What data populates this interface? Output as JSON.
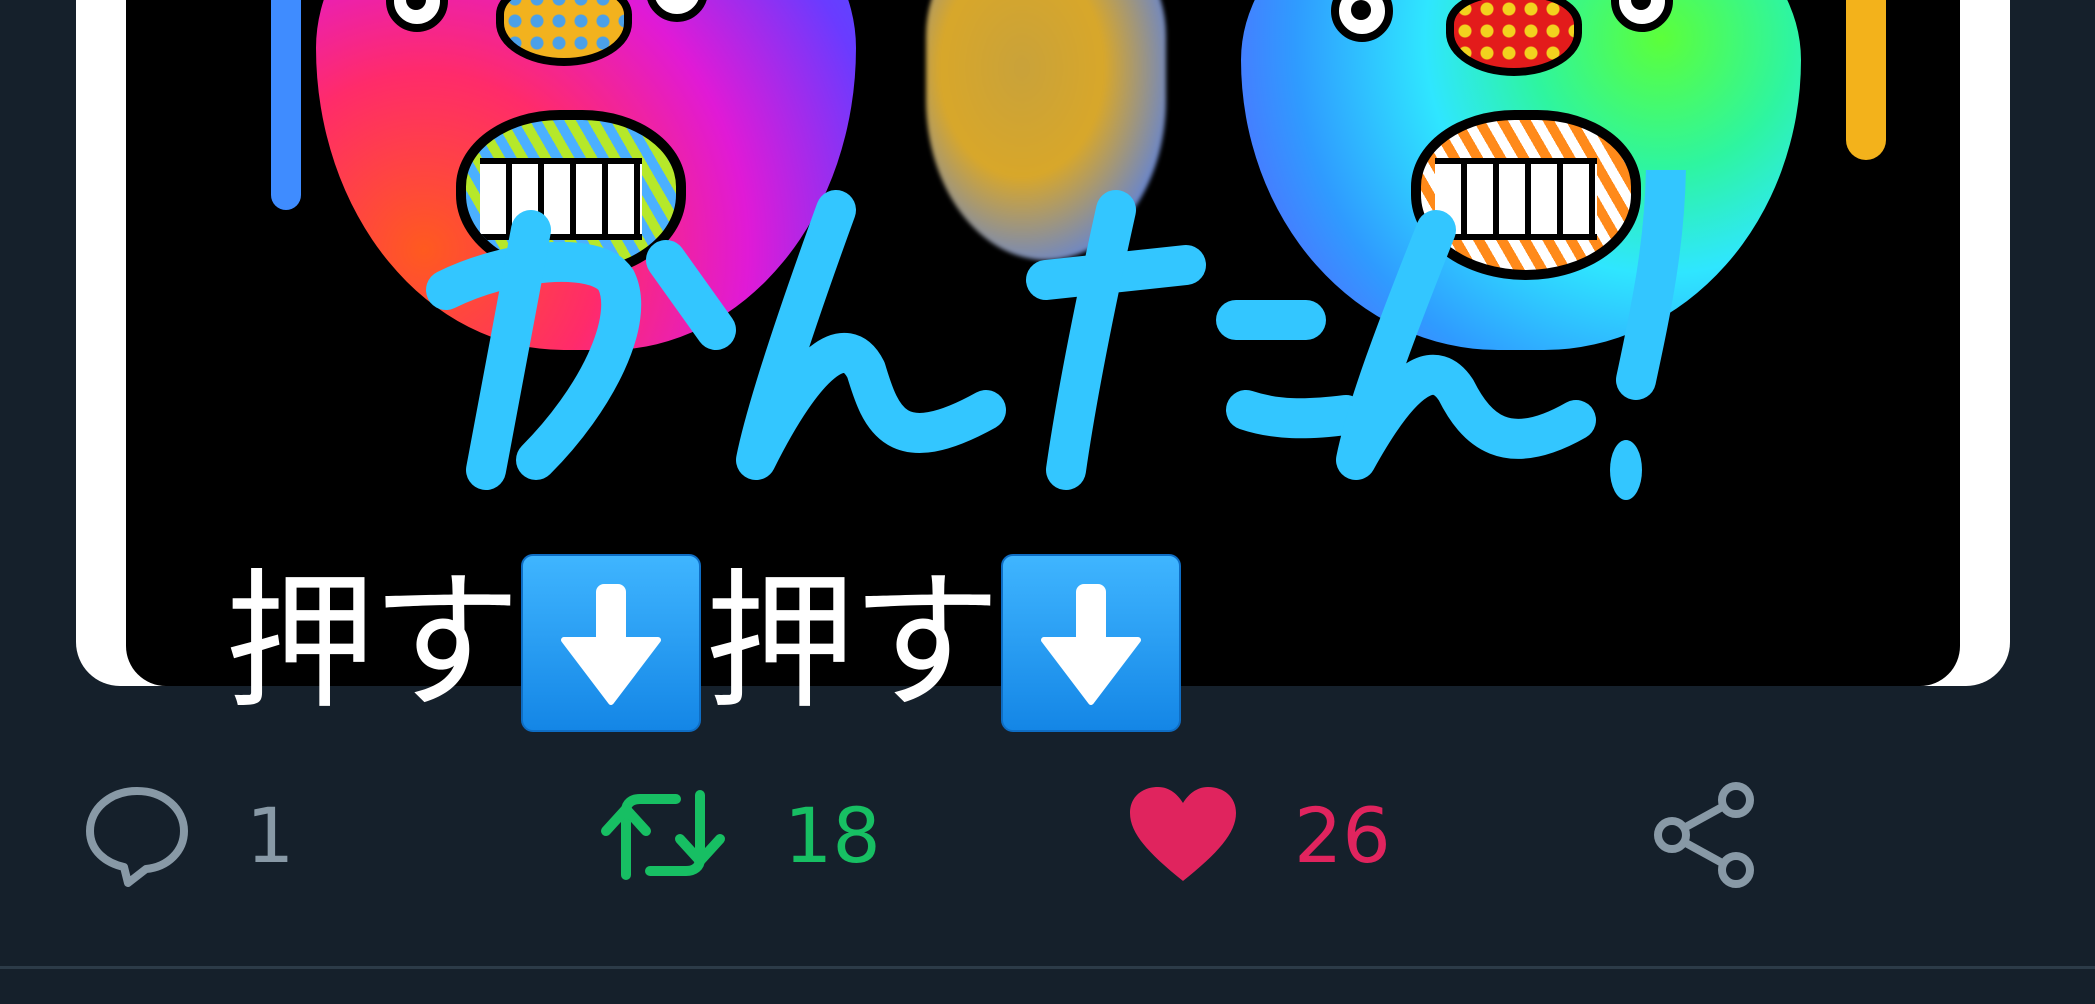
{
  "media": {
    "handwritten_text": "かんたん!"
  },
  "caption": {
    "text_first": "押す",
    "arrow_icon": "down-arrow-emoji",
    "text_second": "押す"
  },
  "actions": {
    "reply": {
      "icon": "reply-icon",
      "count": "1",
      "color": "#8899a6"
    },
    "retweet": {
      "icon": "retweet-icon",
      "count": "18",
      "color": "#17bf63"
    },
    "like": {
      "icon": "heart-icon",
      "count": "26",
      "color": "#e0245e"
    },
    "share": {
      "icon": "share-icon",
      "color": "#8899a6"
    }
  },
  "theme": {
    "background": "#15202b",
    "divider": "#2c3b48",
    "scribble_color": "#33c6ff"
  }
}
